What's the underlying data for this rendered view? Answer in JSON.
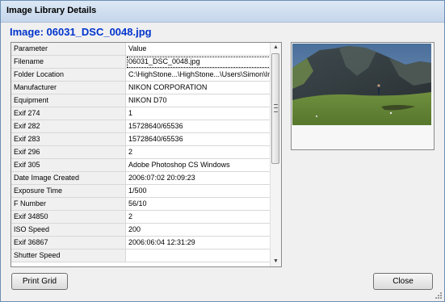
{
  "window": {
    "title": "Image Library Details"
  },
  "image_heading": "Image: 06031_DSC_0048.jpg",
  "grid": {
    "columns": [
      "Parameter",
      "Value"
    ],
    "rows": [
      {
        "param": "Filename",
        "value": "06031_DSC_0048.jpg"
      },
      {
        "param": "Folder Location",
        "value": "C:\\HighStone...\\HighStone...\\Users\\Simon\\In"
      },
      {
        "param": "Manufacturer",
        "value": "NIKON CORPORATION"
      },
      {
        "param": "Equipment",
        "value": "NIKON D70"
      },
      {
        "param": "Exif 274",
        "value": "1"
      },
      {
        "param": "Exif 282",
        "value": "15728640/65536"
      },
      {
        "param": "Exif 283",
        "value": "15728640/65536"
      },
      {
        "param": "Exif 296",
        "value": "2"
      },
      {
        "param": "Exif 305",
        "value": "Adobe Photoshop CS Windows"
      },
      {
        "param": "Date Image Created",
        "value": "2006:07:02 20:09:23"
      },
      {
        "param": "Exposure Time",
        "value": "1/500"
      },
      {
        "param": "F Number",
        "value": "56/10"
      },
      {
        "param": "Exif 34850",
        "value": "2"
      },
      {
        "param": "ISO Speed",
        "value": "200"
      },
      {
        "param": "Exif 36867",
        "value": "2006:06:04 12:31:29"
      },
      {
        "param": "Shutter Speed",
        "value": ""
      }
    ]
  },
  "buttons": {
    "print_grid": "Print Grid",
    "close": "Close"
  },
  "icons": {
    "scroll_up": "scroll-up-arrow-icon",
    "scroll_down": "scroll-down-arrow-icon",
    "resize_grip": "resize-grip-icon"
  },
  "colors": {
    "heading": "#0033cc",
    "title_bar": "#c5d6ea",
    "window_border": "#6d8fb3"
  }
}
